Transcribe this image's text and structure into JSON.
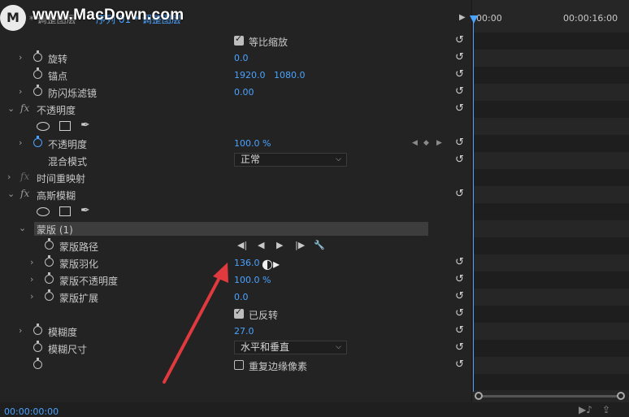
{
  "watermark": "www.MacDown.com",
  "logo_letter": "M",
  "header": {
    "tab1": "主要 * 调整图层",
    "tab2": "序列 01 * 调整图层"
  },
  "timeline": {
    "start": "00:00",
    "end": "00:00:16:00",
    "current_time": "00:00:00:00"
  },
  "rows": {
    "uniform_scale": {
      "label": "等比缩放",
      "checked": true
    },
    "rotation": {
      "label": "旋转",
      "value": "0.0"
    },
    "anchor": {
      "label": "锚点",
      "x": "1920.0",
      "y": "1080.0"
    },
    "antiflicker": {
      "label": "防闪烁滤镜",
      "value": "0.00"
    },
    "opacity_fx": {
      "label": "不透明度"
    },
    "opacity": {
      "label": "不透明度",
      "value": "100.0 %"
    },
    "blend": {
      "label": "混合模式",
      "value": "正常"
    },
    "time_remap": {
      "label": "时间重映射"
    },
    "gaussian": {
      "label": "高斯模糊"
    },
    "mask": {
      "label": "蒙版 (1)"
    },
    "mask_path": {
      "label": "蒙版路径"
    },
    "mask_feather": {
      "label": "蒙版羽化",
      "value": "136.0"
    },
    "mask_opacity": {
      "label": "蒙版不透明度",
      "value": "100.0 %"
    },
    "mask_expansion": {
      "label": "蒙版扩展",
      "value": "0.0"
    },
    "inverted": {
      "label": "已反转",
      "checked": true
    },
    "blurriness": {
      "label": "模糊度",
      "value": "27.0"
    },
    "blur_dim": {
      "label": "模糊尺寸",
      "value": "水平和垂直"
    },
    "repeat_edge": {
      "label": "重复边缘像素",
      "checked": false
    }
  },
  "icons": {
    "reset": "↺",
    "chevron_right": "›",
    "chevron_down": "⌄",
    "mask_path_prev_key": "◀|",
    "mask_path_back": "◀",
    "mask_path_play": "▶",
    "mask_path_next": "|▶",
    "wrench": "🔧"
  },
  "colors": {
    "accent": "#4aa3ff",
    "arrow": "#e0393e"
  }
}
